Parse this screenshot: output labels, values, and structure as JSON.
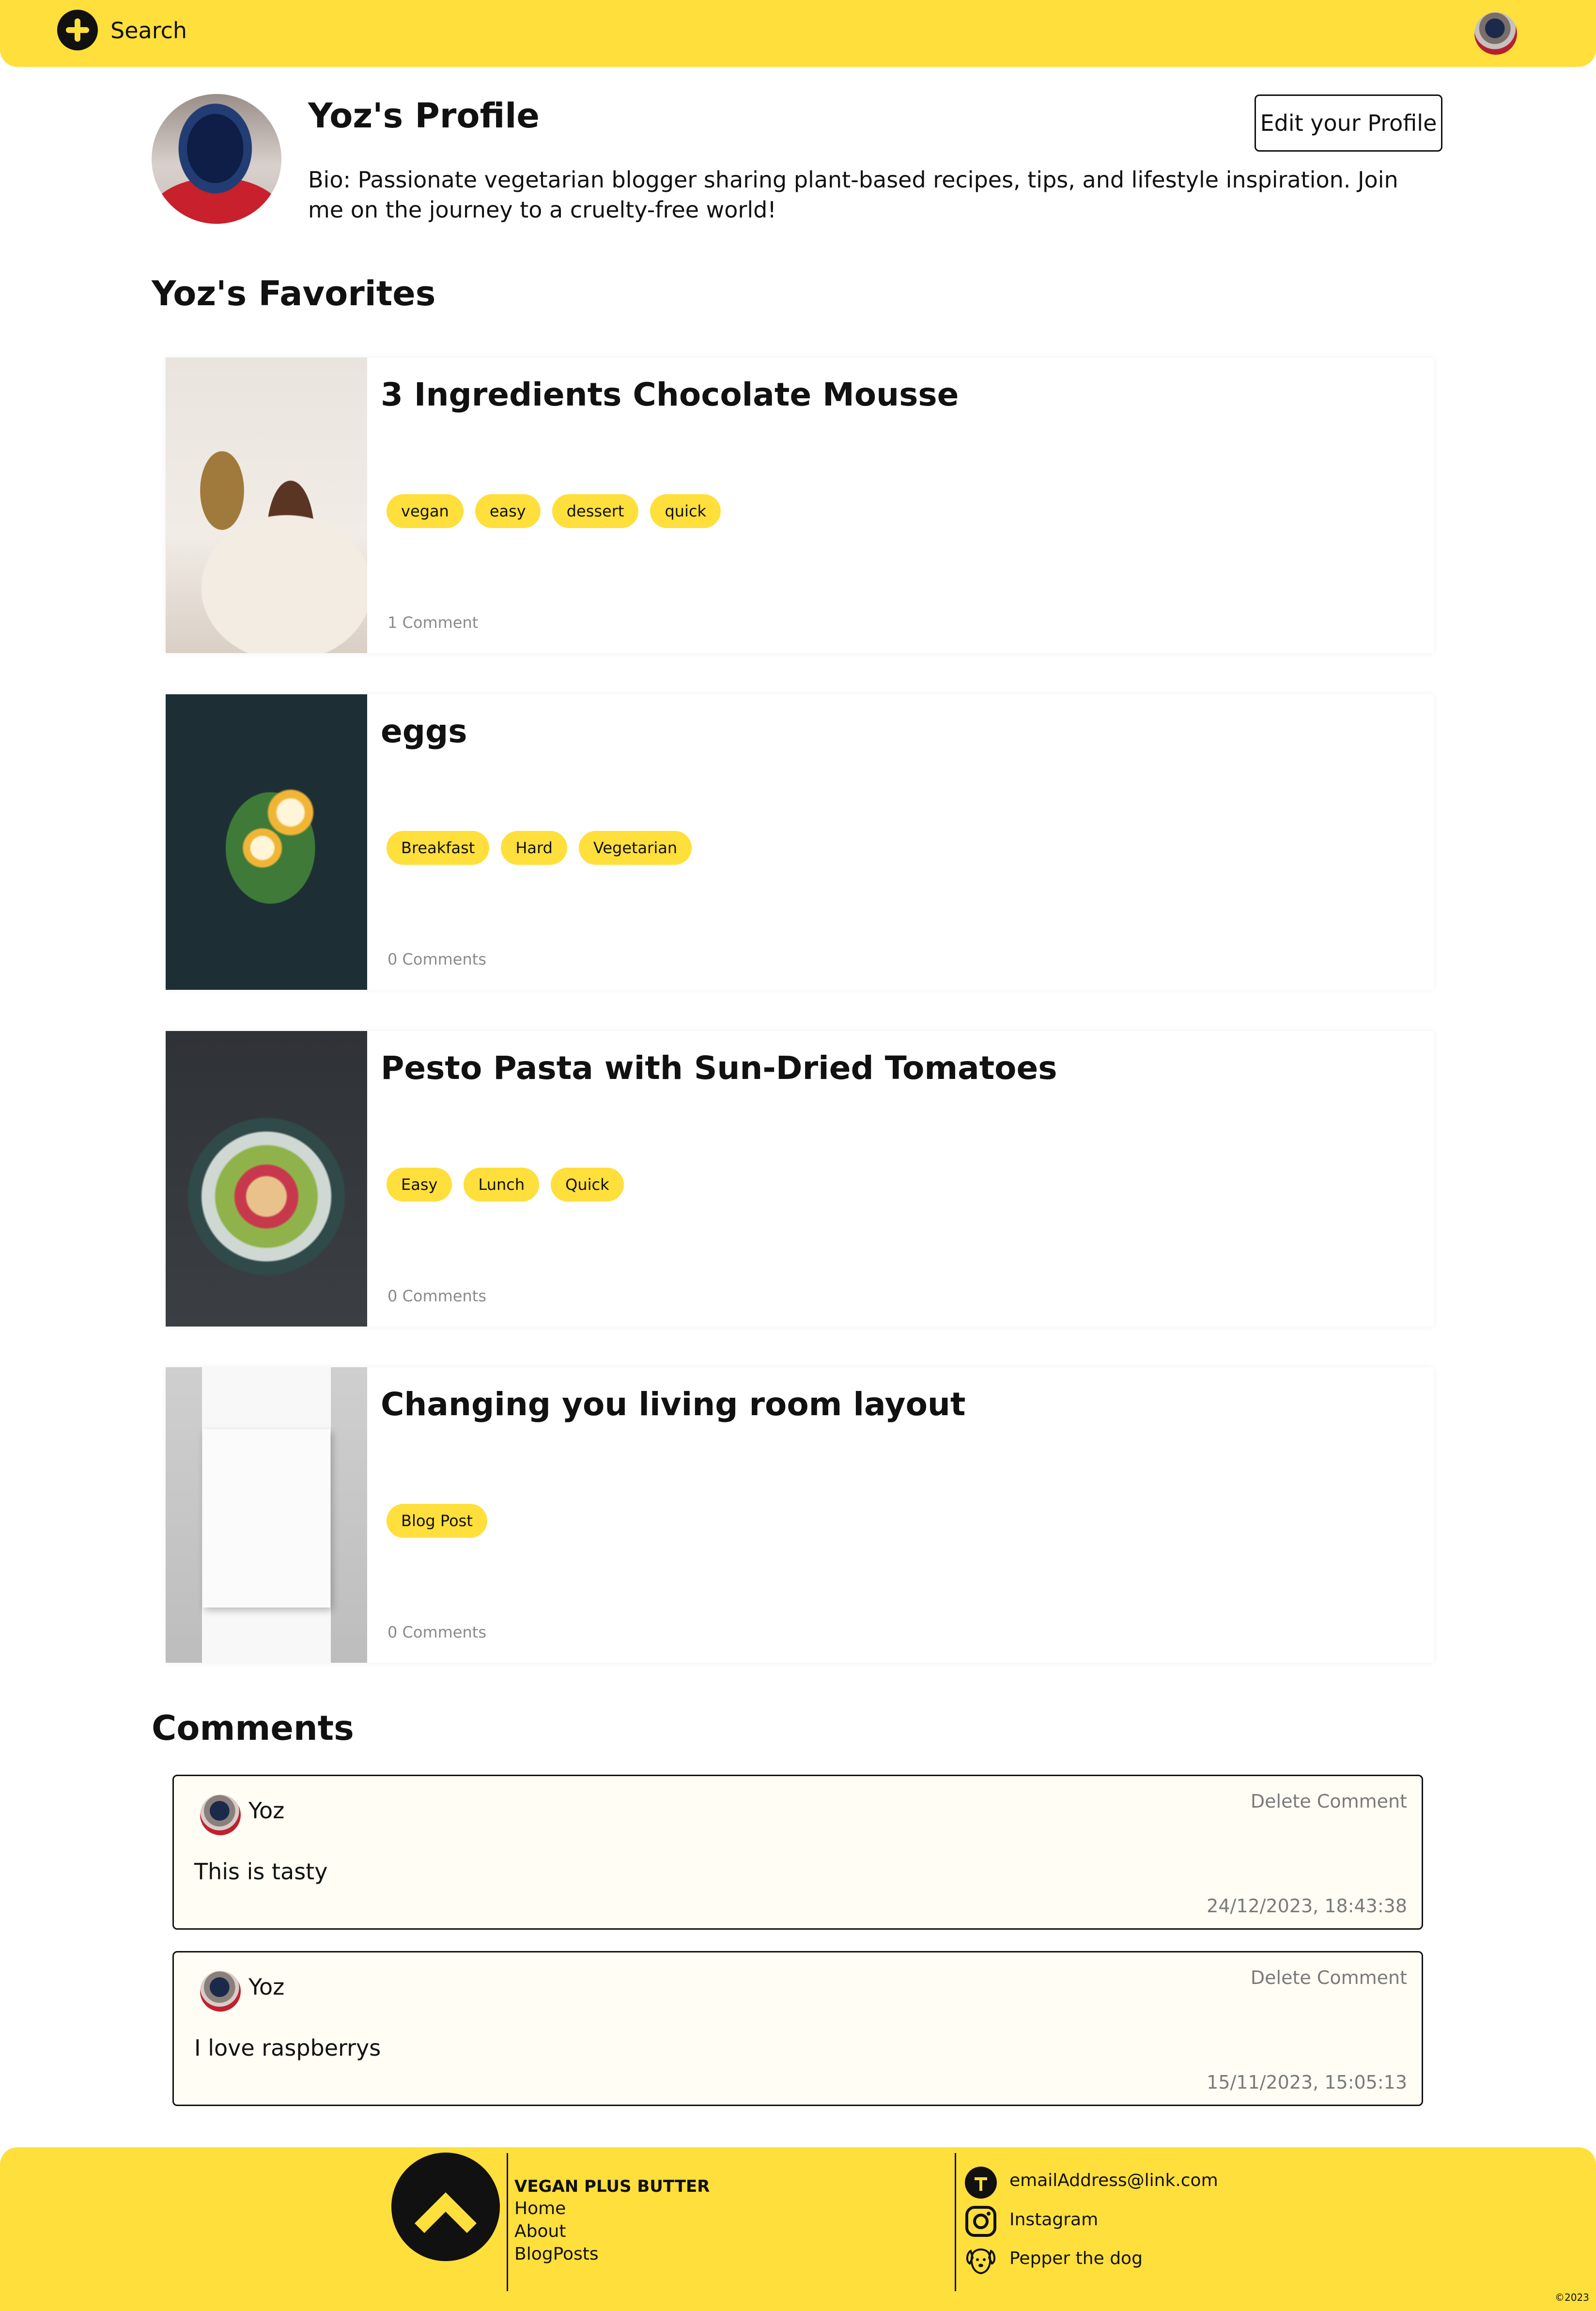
{
  "header": {
    "search_label": "Search"
  },
  "profile": {
    "title": "Yoz's Profile",
    "edit_button": "Edit your Profile",
    "bio": "Bio: Passionate vegetarian blogger sharing plant-based recipes, tips, and lifestyle inspiration. Join me on the journey to a cruelty-free world!"
  },
  "favorites": {
    "heading": "Yoz's Favorites",
    "cards": [
      {
        "title": "3 Ingredients Chocolate Mousse",
        "tags": [
          "vegan",
          "easy",
          "dessert",
          "quick"
        ],
        "comments": "1 Comment"
      },
      {
        "title": "eggs",
        "tags": [
          "Breakfast",
          "Hard",
          "Vegetarian"
        ],
        "comments": "0 Comments"
      },
      {
        "title": "Pesto Pasta with Sun-Dried Tomatoes",
        "tags": [
          "Easy",
          "Lunch",
          "Quick"
        ],
        "comments": "0 Comments"
      },
      {
        "title": "Changing you living room layout",
        "tags": [
          "Blog Post"
        ],
        "comments": "0 Comments"
      }
    ]
  },
  "comments": {
    "heading": "Comments",
    "items": [
      {
        "author": "Yoz",
        "text": "This is tasty",
        "date": "24/12/2023, 18:43:38",
        "delete_label": "Delete Comment"
      },
      {
        "author": "Yoz",
        "text": "I love raspberrys",
        "date": "15/11/2023, 15:05:13",
        "delete_label": "Delete Comment"
      }
    ]
  },
  "footer": {
    "brand": "VEGAN PLUS BUTTER",
    "links": [
      "Home",
      "About",
      "BlogPosts"
    ],
    "contacts": [
      {
        "label": "emailAddress@link.com",
        "icon": "email-icon"
      },
      {
        "label": "Instagram",
        "icon": "instagram-icon"
      },
      {
        "label": "Pepper the dog",
        "icon": "dog-icon"
      }
    ],
    "copyright": "©2023"
  },
  "colors": {
    "accent": "#ffdf3b",
    "text": "#111111",
    "muted": "#7a7a7a"
  }
}
